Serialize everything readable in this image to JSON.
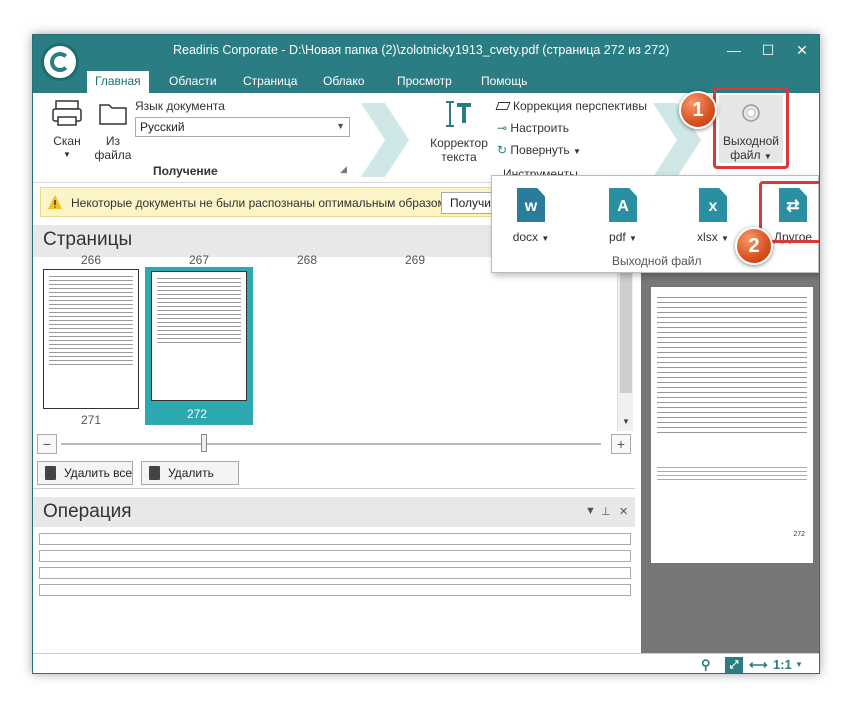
{
  "window": {
    "title": "Readiris Corporate - D:\\Новая папка (2)\\zolotnicky1913_cvety.pdf (страница 272 из 272)",
    "minimize": "—",
    "maximize": "☐",
    "close": "✕"
  },
  "tabs": [
    "Главная",
    "Области",
    "Страница",
    "Облако",
    "Просмотр",
    "Помощь"
  ],
  "ribbon": {
    "scan_label": "Скан",
    "fromfile_label_1": "Из",
    "fromfile_label_2": "файла",
    "doclang_label": "Язык документа",
    "doclang_value": "Русский",
    "group_get": "Получение",
    "corrector_1": "Корректор",
    "corrector_2": "текста",
    "perspective": "Коррекция перспективы",
    "adjust": "Настроить",
    "rotate": "Повернуть",
    "tools_group": "Инструменты",
    "output_1": "Выходной",
    "output_2": "файл"
  },
  "notice": {
    "text": "Некоторые документы не были распознаны оптимальным образом.",
    "button": "Получи"
  },
  "pages": {
    "header": "Страницы",
    "top_numbers": [
      "266",
      "267",
      "268",
      "269"
    ],
    "thumb_numbers": [
      "271",
      "272"
    ],
    "delete_all": "Удалить все",
    "delete": "Удалить"
  },
  "operation": {
    "header": "Операция"
  },
  "output_dropdown": {
    "formats": [
      {
        "label": "docx",
        "glyph": "w"
      },
      {
        "label": "pdf",
        "glyph": "A"
      },
      {
        "label": "xlsx",
        "glyph": "x"
      },
      {
        "label": "Другое",
        "glyph": "⇄"
      }
    ],
    "group_label": "Выходной файл"
  },
  "badges": [
    "1",
    "2"
  ],
  "preview": {
    "page_number": "272"
  },
  "status": {
    "zoom": "1:1"
  }
}
